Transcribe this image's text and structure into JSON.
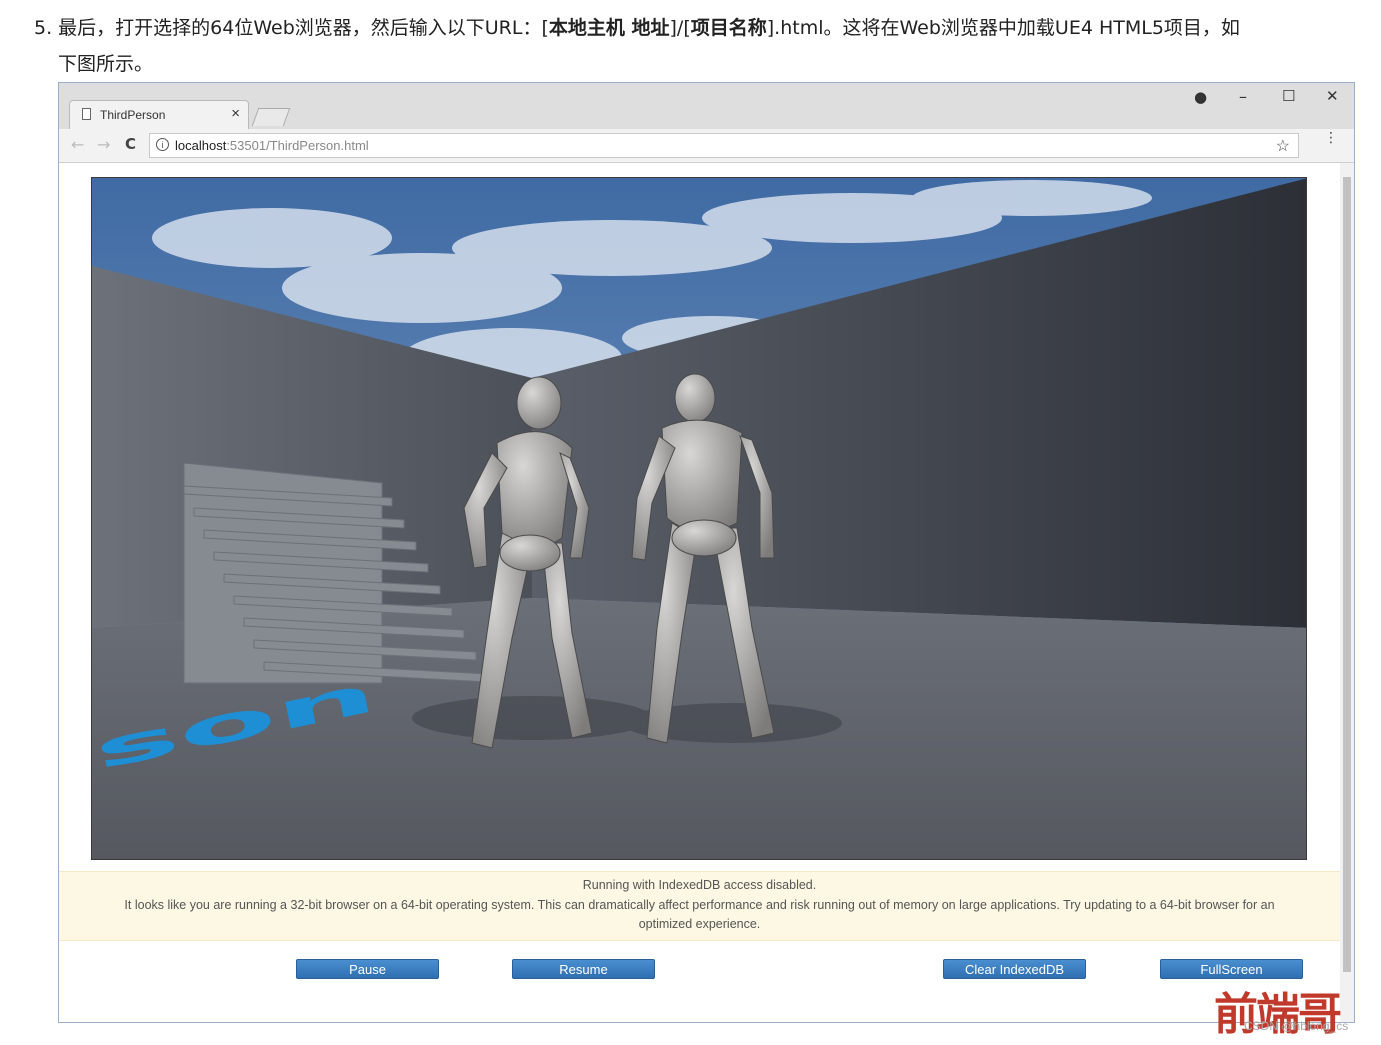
{
  "doc": {
    "prefix": "5. 最后，打开选择的64位Web浏览器，然后输入以下URL：[",
    "bold1": "本地主机 地址",
    "mid": "]/[",
    "bold2": "项目名称",
    "suffix": "].html。这将在Web浏览器中加载UE4 HTML5项目，如",
    "line2": "下图所示。"
  },
  "browser": {
    "tab_title": "ThirdPerson",
    "tab_close": "×",
    "controls": {
      "profile": "●",
      "minimize": "–",
      "maximize": "☐",
      "close": "✕"
    },
    "nav": {
      "back": "←",
      "forward": "→",
      "reload": "C"
    },
    "address": {
      "info": "i",
      "host": "localhost",
      "path": ":53501/ThirdPerson.html"
    },
    "bookmark": "☆",
    "menu": "⋮"
  },
  "scene": {
    "floor_text": "son",
    "colors": {
      "sky": "#4c73a8",
      "wall": "#4e525c",
      "floor": "#5f636b",
      "mannequin": "#a9a8a7",
      "floor_text": "#1e8fd4"
    }
  },
  "notice": {
    "line1": "Running with IndexedDB access disabled.",
    "line2": "It looks like you are running a 32-bit browser on a 64-bit operating system. This can dramatically affect performance and risk running out of memory on large applications. Try updating to a 64-bit browser for an",
    "line3": "optimized experience."
  },
  "buttons": {
    "pause": "Pause",
    "resume": "Resume",
    "clear": "Clear IndexedDB",
    "fullscreen": "FullScreen"
  },
  "watermark": {
    "logo": "前端哥",
    "sub": "CSDN @hblong_cs"
  }
}
